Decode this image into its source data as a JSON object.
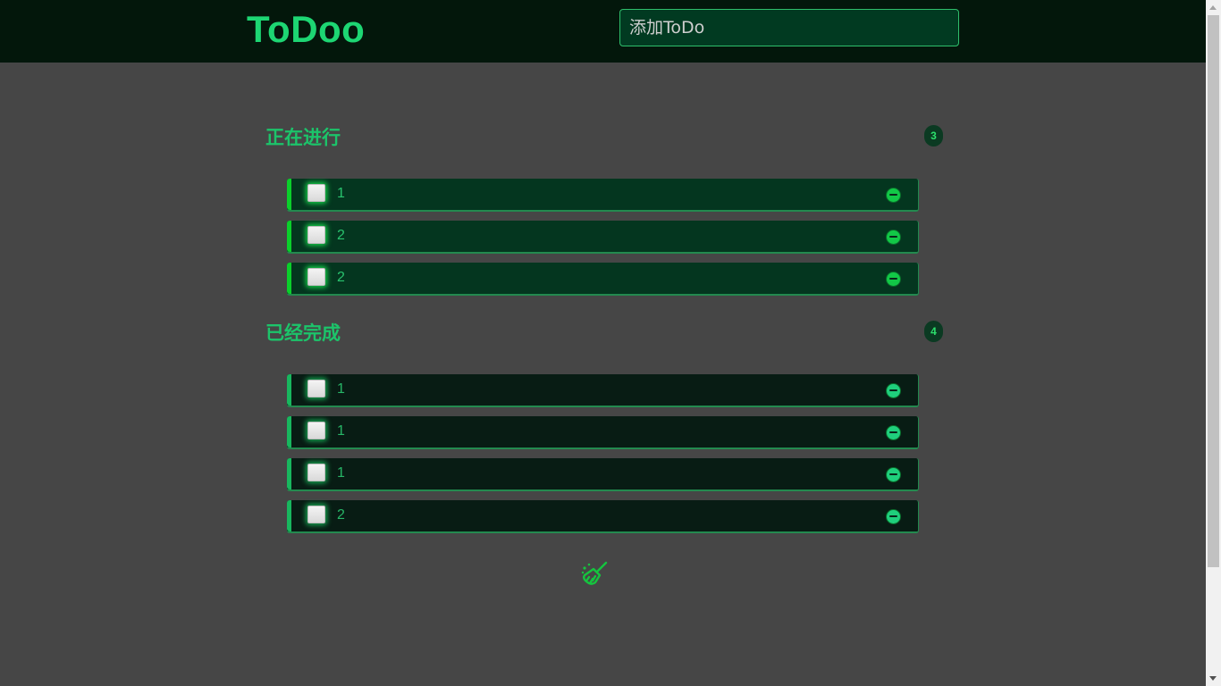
{
  "header": {
    "logo": "ToDoo",
    "add_input": {
      "value": "",
      "placeholder": "添加ToDo"
    }
  },
  "sections": [
    {
      "title": "正在进行",
      "count": "3",
      "items": [
        {
          "text": "1",
          "checked": false
        },
        {
          "text": "2",
          "checked": false
        },
        {
          "text": "2",
          "checked": false
        }
      ]
    },
    {
      "title": "已经完成",
      "count": "4",
      "items": [
        {
          "text": "1",
          "checked": false
        },
        {
          "text": "1",
          "checked": false
        },
        {
          "text": "1",
          "checked": false
        },
        {
          "text": "2",
          "checked": false
        }
      ]
    }
  ],
  "icons": {
    "remove": "minus-circle-icon",
    "clear": "broom-icon"
  },
  "colors": {
    "accent": "#1dd673",
    "header_bg": "#03170b",
    "page_bg": "#464646",
    "doing_item_bg": "#04361f",
    "done_item_bg": "#081c14"
  }
}
